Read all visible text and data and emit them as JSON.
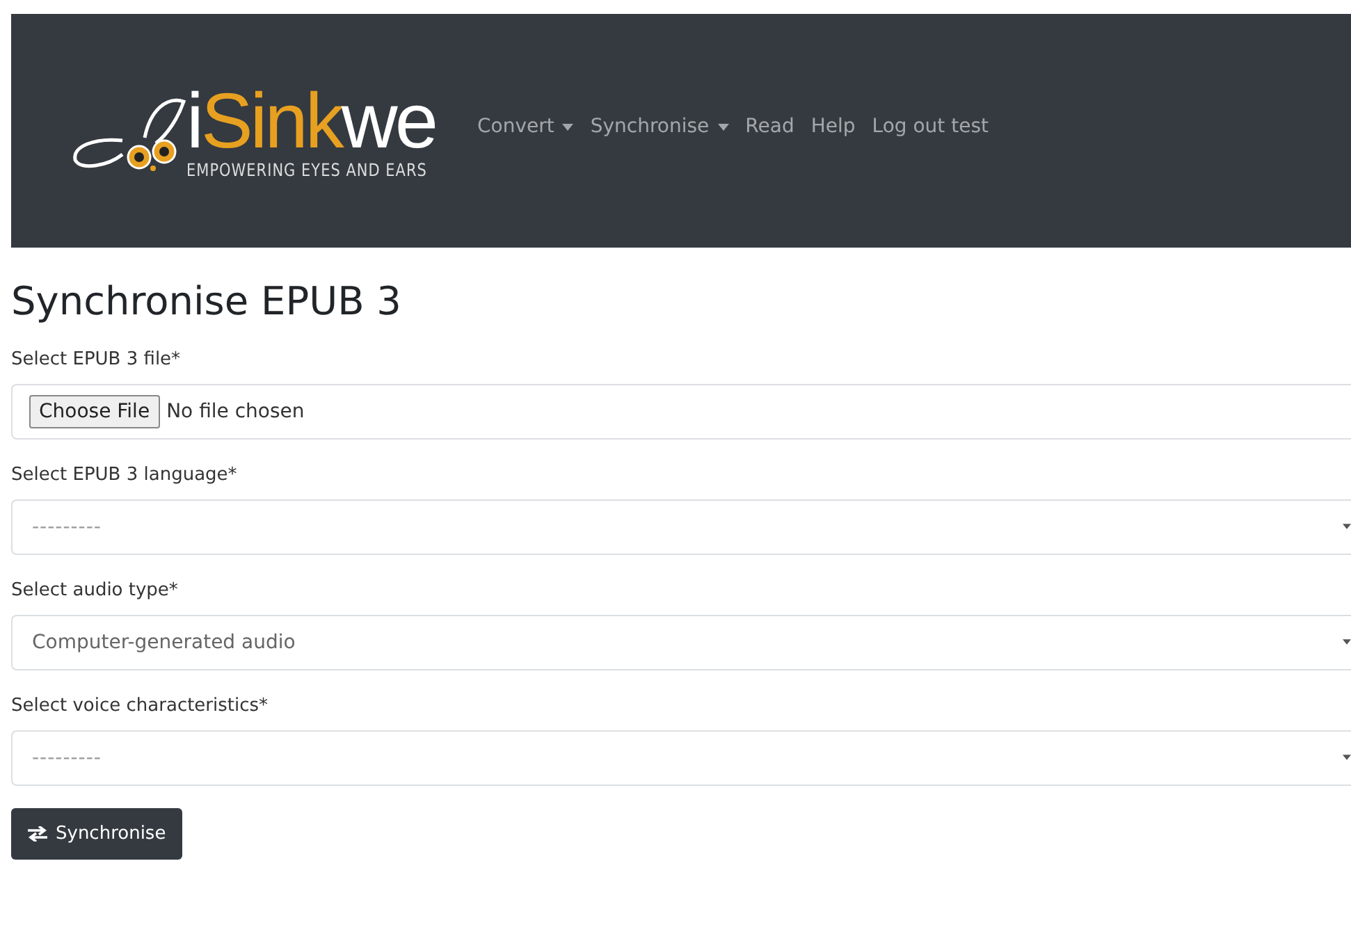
{
  "navbar": {
    "logo": {
      "parts": [
        {
          "text": "i",
          "color": "#ffffff"
        },
        {
          "text": "Sink",
          "color": "#e8a020"
        },
        {
          "text": "we",
          "color": "#ffffff"
        }
      ],
      "tagline": "EMPOWERING EYES AND EARS"
    },
    "items": [
      {
        "label": "Convert",
        "dropdown": true
      },
      {
        "label": "Synchronise",
        "dropdown": true
      },
      {
        "label": "Read",
        "dropdown": false
      },
      {
        "label": "Help",
        "dropdown": false
      },
      {
        "label": "Log out test",
        "dropdown": false
      }
    ]
  },
  "title": "Synchronise EPUB 3",
  "fields": [
    {
      "kind": "file",
      "label": "Select EPUB 3 file*",
      "button": "Choose File",
      "value": "No file chosen"
    },
    {
      "kind": "select",
      "label": "Select EPUB 3 language*",
      "value": "---------"
    },
    {
      "kind": "select",
      "label": "Select audio type*",
      "value": "Computer-generated audio"
    },
    {
      "kind": "select",
      "label": "Select voice characteristics*",
      "value": "---------"
    }
  ],
  "submit": {
    "label": "Synchronise"
  }
}
